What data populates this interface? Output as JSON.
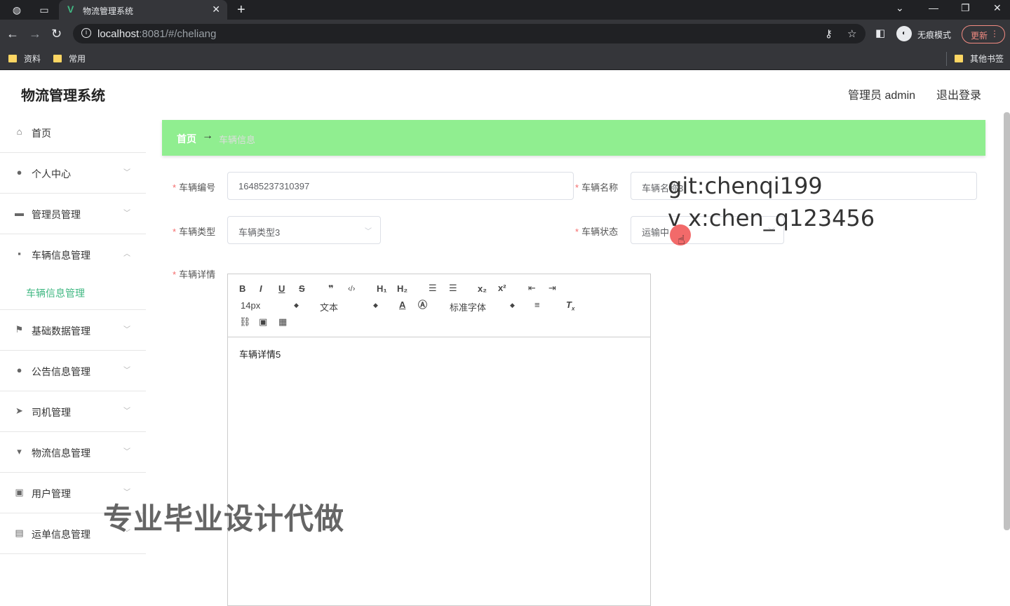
{
  "browser": {
    "tab_title": "物流管理系统",
    "tab_logo": "V",
    "url_host": "localhost",
    "url_path": ":8081/#/cheliang",
    "profile_label": "无痕模式",
    "update_label": "更新",
    "bookmarks": [
      "资料",
      "常用"
    ],
    "other_bookmarks": "其他书签"
  },
  "app": {
    "title": "物流管理系统",
    "admin_label": "管理员 admin",
    "logout_label": "退出登录"
  },
  "sidebar": {
    "items": [
      {
        "label": "首页",
        "icon": "home-icon"
      },
      {
        "label": "个人中心",
        "icon": "user-icon"
      },
      {
        "label": "管理员管理",
        "icon": "briefcase-icon"
      },
      {
        "label": "车辆信息管理",
        "icon": "chat-icon"
      },
      {
        "label": "基础数据管理",
        "icon": "flag-icon"
      },
      {
        "label": "公告信息管理",
        "icon": "location-icon"
      },
      {
        "label": "司机管理",
        "icon": "send-icon"
      },
      {
        "label": "物流信息管理",
        "icon": "sign-icon"
      },
      {
        "label": "用户管理",
        "icon": "chart-icon"
      },
      {
        "label": "运单信息管理",
        "icon": "ticket-icon"
      }
    ],
    "submenu_label": "车辆信息管理"
  },
  "breadcrumb": {
    "home": "首页",
    "arrow": "→",
    "current": "车辆信息"
  },
  "form": {
    "vehicle_no_label": "车辆编号",
    "vehicle_no_value": "16485237310397",
    "vehicle_name_label": "车辆名称",
    "vehicle_name_value": "车辆名称3",
    "vehicle_type_label": "车辆类型",
    "vehicle_type_value": "车辆类型3",
    "vehicle_status_label": "车辆状态",
    "vehicle_status_value": "运输中",
    "vehicle_detail_label": "车辆详情",
    "required_mark": "*"
  },
  "editor": {
    "font_size": "14px",
    "paragraph": "文本",
    "font_family": "标准字体",
    "content": "车辆详情5"
  },
  "overlays": {
    "git": "git:chenqi199",
    "vx": "v x:chen_q123456",
    "watermark": "专业毕业设计代做"
  }
}
